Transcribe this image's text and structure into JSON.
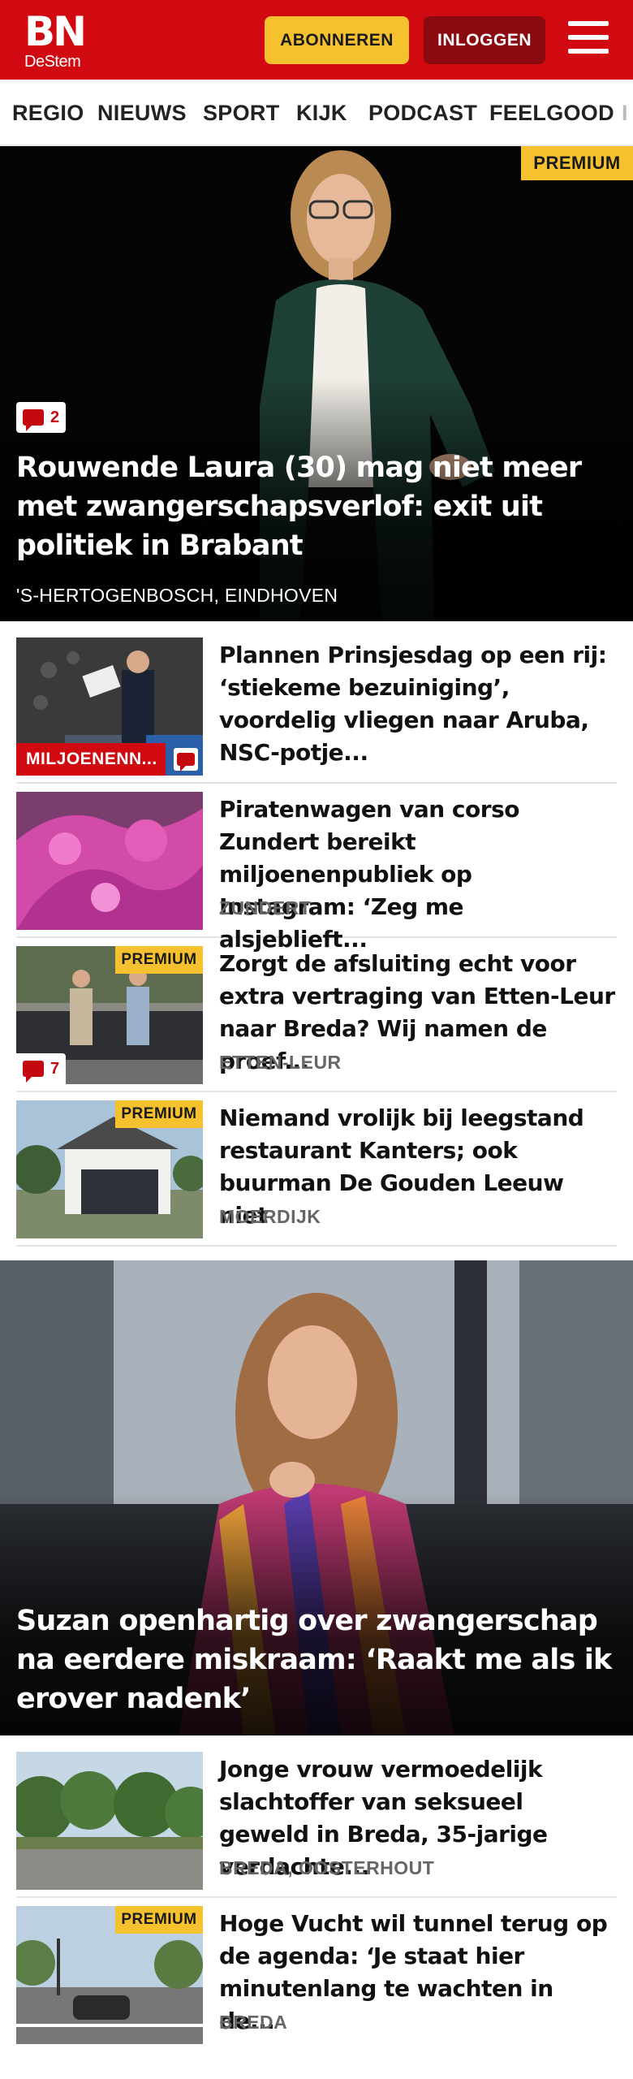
{
  "header": {
    "logo_main": "BN",
    "logo_sub": "DeStem",
    "subscribe_label": "ABONNEREN",
    "login_label": "INLOGGEN",
    "menu_icon": "hamburger-icon",
    "brand_color": "#d10a11",
    "accent_color": "#f6c12f"
  },
  "nav": {
    "items": [
      "REGIO",
      "NIEUWS",
      "SPORT",
      "KIJK",
      "PODCAST",
      "FEELGOOD",
      "I"
    ]
  },
  "hero": {
    "premium": "PREMIUM",
    "comment_count": "2",
    "title": "Rouwende Laura (30) mag niet meer met zwangerschapsverlof: exit uit politiek in Brabant",
    "location": "'S-HERTOGENBOSCH, EINDHOVEN"
  },
  "articles": [
    {
      "title": "Plannen Prinsjesdag op een rij: ‘stiekeme bezuiniging’, voordelig vliegen naar Aruba, NSC-potje...",
      "label": "MILJOENENN...",
      "location": ""
    },
    {
      "title": "Piratenwagen van corso Zundert bereikt miljoenenpubliek op Instagram: ‘Zeg me alsjeblieft...",
      "location": "ZUNDERT"
    },
    {
      "title": "Zorgt de afsluiting echt voor extra vertraging van Etten-Leur naar Breda? Wij namen de proef...",
      "location": "ETTEN-LEUR",
      "premium": "PREMIUM",
      "comment_count": "7"
    },
    {
      "title": "Niemand vrolijk bij leegstand restaurant Kanters; ook buurman De Gouden Leeuw niet",
      "location": "MOERDIJK",
      "premium": "PREMIUM"
    }
  ],
  "hero2": {
    "title": "Suzan openhartig over zwangerschap na eerdere miskraam: ‘Raakt me als ik erover nadenk’"
  },
  "articles2": [
    {
      "title": "Jonge vrouw vermoedelijk slachtoffer van seksueel geweld in Breda, 35-jarige verdachte...",
      "location": "BREDA, OOSTERHOUT"
    },
    {
      "title": "Hoge Vucht wil tunnel terug op de agenda: ‘Je staat hier minutenlang te wachten in de...",
      "location": "BREDA",
      "premium": "PREMIUM"
    }
  ]
}
